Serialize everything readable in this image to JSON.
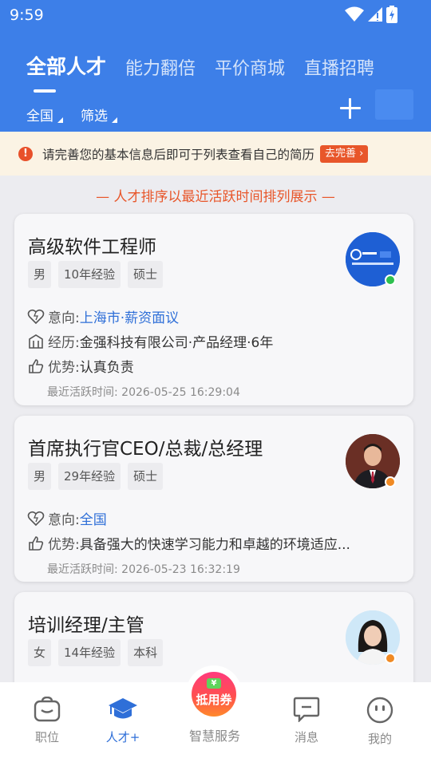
{
  "status_bar": {
    "time": "9:59"
  },
  "header": {
    "tabs": [
      {
        "label": "全部人才",
        "active": true
      },
      {
        "label": "能力翻倍",
        "active": false
      },
      {
        "label": "平价商城",
        "active": false
      },
      {
        "label": "直播招聘",
        "active": false
      }
    ],
    "filters": [
      {
        "label": "全国"
      },
      {
        "label": "筛选"
      }
    ],
    "add_icon": "plus-icon",
    "accent_color": "#3d7fe8"
  },
  "notice": {
    "icon": "alert-icon",
    "text": "请完善您的基本信息后即可于列表查看自己的简历",
    "button": "去完善 ›"
  },
  "sort_tip": "— 人才排序以最近活跃时间排列展示 —",
  "candidates": [
    {
      "title": "高级软件工程师",
      "tags": [
        "男",
        "10年经验",
        "硕士"
      ],
      "intent_label": "意向:",
      "intent_value": "上海市·薪资面议",
      "experience_label": "经历:",
      "experience_value": "金强科技有限公司·产品经理·6年",
      "strength_label": "优势:",
      "strength_value": "认真负责",
      "active_time": "最近活跃时间: 2026-05-25 16:29:04",
      "status_color": "#2ec04f"
    },
    {
      "title": "首席执行官CEO/总裁/总经理",
      "tags": [
        "男",
        "29年经验",
        "硕士"
      ],
      "intent_label": "意向:",
      "intent_value": "全国",
      "strength_label": "优势:",
      "strength_value": "具备强大的快速学习能力和卓越的环境适应...",
      "active_time": "最近活跃时间: 2026-05-23 16:32:19",
      "status_color": "#f08a24"
    },
    {
      "title": "培训经理/主管",
      "tags": [
        "女",
        "14年经验",
        "本科"
      ],
      "status_color": "#f08a24"
    }
  ],
  "bottom_nav": {
    "items": [
      {
        "label": "职位",
        "icon": "briefcase-icon",
        "active": false
      },
      {
        "label": "人才+",
        "icon": "graduation-cap-icon",
        "active": true
      },
      {
        "label": "智慧服务",
        "icon": "coupon-icon",
        "active": false
      },
      {
        "label": "消息",
        "icon": "message-icon",
        "active": false
      },
      {
        "label": "我的",
        "icon": "smiley-icon",
        "active": false
      }
    ],
    "coupon_badge": "¥",
    "coupon_text": "抵用券"
  }
}
